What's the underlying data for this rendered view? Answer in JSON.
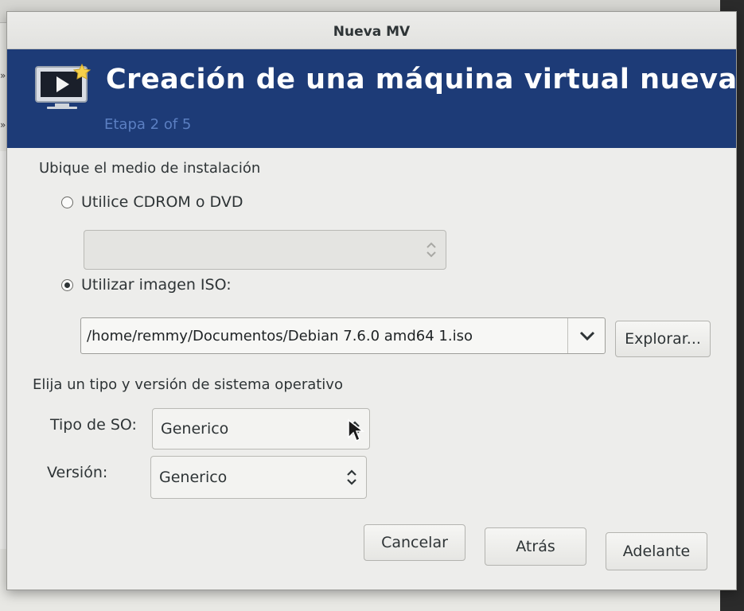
{
  "dialog": {
    "title": "Nueva MV",
    "banner_title": "Creación de una máquina virtual nueva",
    "step": "Etapa 2 of 5"
  },
  "install_media": {
    "section_label": "Ubique el medio de instalación",
    "cdrom_label": "Utilice CDROM o DVD",
    "cdrom_selected": false,
    "cdrom_value": "",
    "iso_label": "Utilizar imagen ISO:",
    "iso_selected": true,
    "iso_path": "/home/remmy/Documentos/Debian 7.6.0 amd64 1.iso",
    "browse_label": "Explorar..."
  },
  "os": {
    "section_label": "Elija un tipo y versión de sistema operativo",
    "type_label": "Tipo de SO:",
    "type_value": "Generico",
    "version_label": "Versión:",
    "version_value": "Generico"
  },
  "footer": {
    "cancel_label": "Cancelar",
    "back_label": "Atrás",
    "forward_label": "Adelante"
  },
  "colors": {
    "banner": "#1d3b77",
    "banner_step_text": "#5b7fc2"
  },
  "icons": {
    "banner": "vm-screen-icon",
    "spin": "up-down-chevron-icon",
    "dropdown": "chevron-down-icon"
  }
}
